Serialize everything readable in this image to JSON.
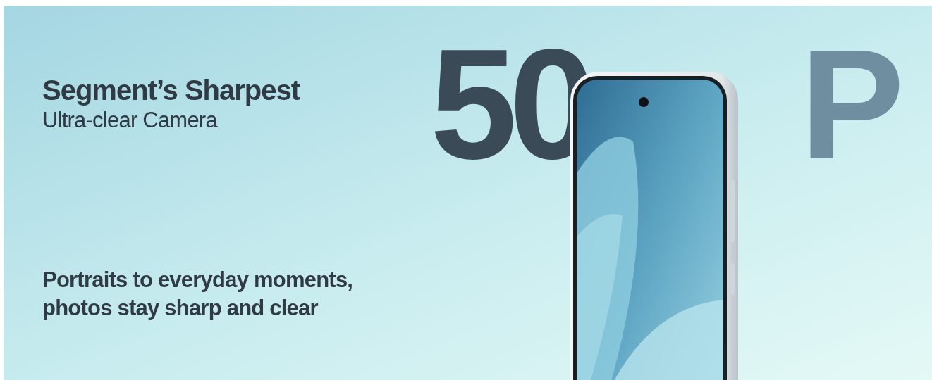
{
  "banner": {
    "title": "Segment’s Sharpest",
    "subtitle": "Ultra-clear Camera",
    "big_text": [
      "50",
      "P"
    ],
    "caption_lines": [
      "Portraits to everyday moments,",
      "photos stay sharp and clear"
    ]
  }
}
